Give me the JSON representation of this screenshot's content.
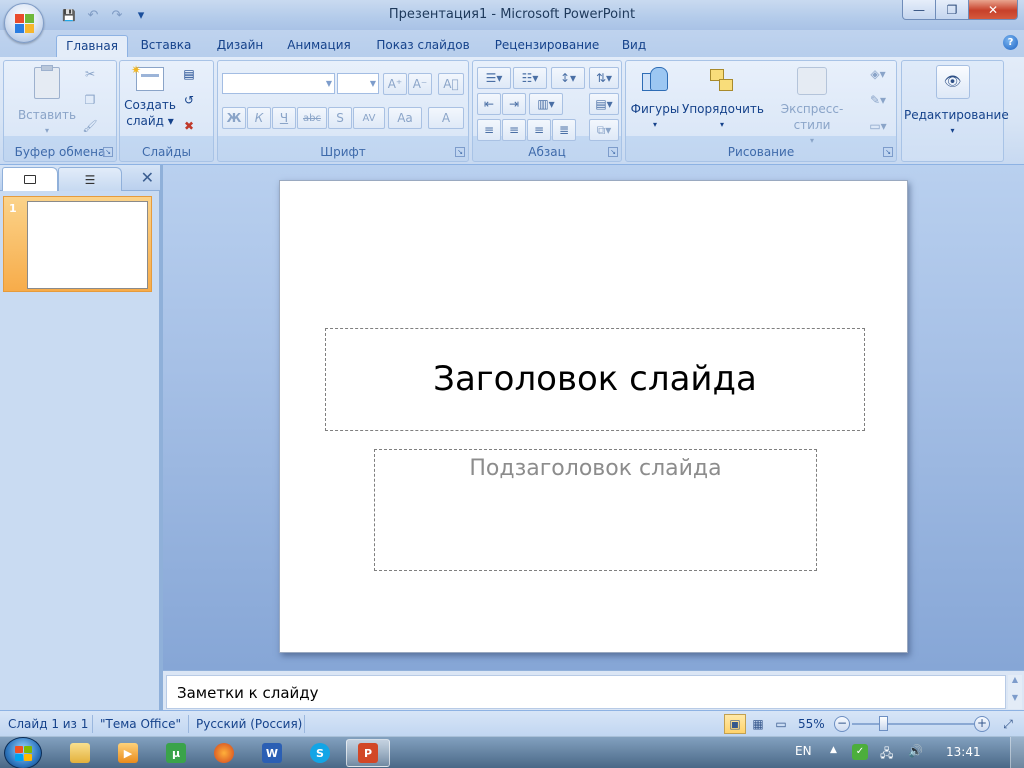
{
  "window": {
    "title": "Презентация1 - Microsoft PowerPoint",
    "minimize": "—",
    "maximize": "❐",
    "close": "✕"
  },
  "qat": {
    "save": "💾",
    "undo": "↶",
    "redo": "↷",
    "customize": "▾"
  },
  "tabs": [
    "Главная",
    "Вставка",
    "Дизайн",
    "Анимация",
    "Показ слайдов",
    "Рецензирование",
    "Вид"
  ],
  "help": "?",
  "ribbon": {
    "clipboard": {
      "label": "Буфер обмена",
      "paste": "Вставить",
      "cut": "✂",
      "copy": "❐",
      "format_painter": "🖌"
    },
    "slides": {
      "label": "Слайды",
      "new_slide_line1": "Создать",
      "new_slide_line2": "слайд",
      "layout": "▤",
      "reset": "↺",
      "delete": "✖"
    },
    "font": {
      "label": "Шрифт",
      "grow": "A⁺",
      "shrink": "A⁻",
      "clear": "A⃠",
      "bold": "Ж",
      "italic": "К",
      "underline": "Ч",
      "strike": "abc",
      "shadow": "S",
      "spacing": "AV",
      "case": "Aa",
      "color": "A"
    },
    "paragraph": {
      "label": "Абзац"
    },
    "drawing": {
      "label": "Рисование",
      "shapes": "Фигуры",
      "arrange": "Упорядочить",
      "quick_styles": "Экспресс-стили"
    },
    "editing": {
      "label": "Редактирование"
    }
  },
  "slide_pane": {
    "thumbnail_number": "1",
    "close": "✕"
  },
  "slide": {
    "title_placeholder": "Заголовок слайда",
    "subtitle_placeholder": "Подзаголовок слайда"
  },
  "notes": {
    "placeholder": "Заметки к слайду"
  },
  "status": {
    "slide_info": "Слайд 1 из 1",
    "theme": "\"Тема Office\"",
    "language": "Русский (Россия)",
    "zoom": "55%",
    "zoom_fraction": 0.55
  },
  "taskbar": {
    "lang": "EN",
    "time": "13:41"
  },
  "colors": {
    "ribbon_text": "#15428b",
    "thumb_selected": "#f7ac4a",
    "close_red": "#c7402a"
  }
}
